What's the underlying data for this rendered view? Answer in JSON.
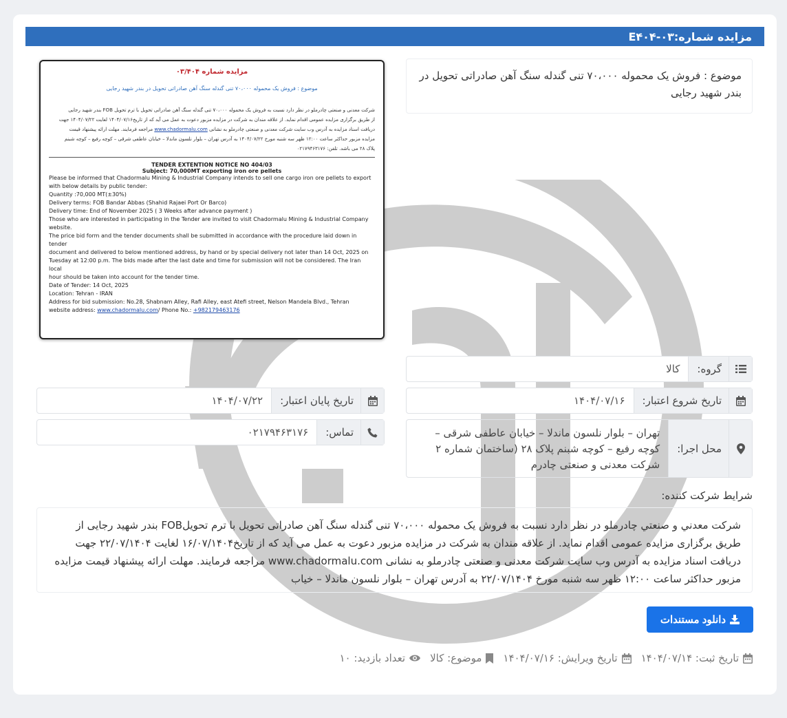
{
  "title": "مزایده شماره:۰۳-E۴۰۴",
  "subject": "موضوع : فروش یک محموله ۷۰،۰۰۰ تنی گندله سنگ آهن صادراتی تحویل در بندر شهید رجایی",
  "document_image": {
    "fa_title": "مزایده شماره ۰۳/۴۰۴",
    "fa_subject": "موضوع : فروش یک محموله   ۷۰،۰۰۰ تنی گندله سنگ آهن صادراتی تحویل در بندر شهید رجایی",
    "fa_line1": "شرکت معدنی و صنعتی چادرملو در نظر دارد نسبت به فروش یک محموله   ۷۰،۰۰۰ تنی گندله سنگ آهن صادراتی تحویل با ترم تحویل FOB بندر شهید رجایی",
    "fa_line2": "از طریق برگزاری مزایده عمومی اقدام نماید. از علاقه مندان به شرکت در مزایده مزبور دعوت به عمل می آید که از تاریخ۱۴۰۴/۰۷/۱۶ لغایت ۱۴۰۴/۰۷/۲۲ جهت",
    "fa_line3a": "دریافت اسناد مزایده به آدرس وب سایت شرکت معدنی و صنعتی چادرملو به نشانی",
    "fa_line3_link": "www.chadormalu.com",
    "fa_line3b": "مراجعه فرمایند. مهلت ارائه پیشنهاد قیمت",
    "fa_line4": "مزایده مزبور حداکثر ساعت ۱۲:۰۰ ظهر سه شنبه  مورخ ۱۴۰۴/۰۷/۲۲  به آدرس تهران – بلوار نلسون ماندلا – خیابان عاطفی شرقی – کوچه رفیع – کوچه شبنم",
    "fa_line5": "پلاک ۲۸ می باشد. تلفن: ۰۲۱۷۹۴۶۳۱۷۶",
    "en_title": "TENDER EXTENTION NOTICE NO 404/03",
    "en_subject": "Subject: 70,000MT exporting iron ore pellets",
    "en_lines": [
      "Please be informed that Chadormalu Mining & Industrial Company intends to sell one cargo iron ore pellets to export",
      "with below details by public tender:",
      "Quantity :70,000 MT(±30%)",
      "Delivery terms: FOB Bandar Abbas (Shahid Rajaei Port Or Barco)",
      "Delivery time:  End of November 2025 ( 3 Weeks after advance payment )",
      "Those who are interested in participating in the Tender are invited to visit Chadormalu Mining & Industrial Company",
      "website.",
      "The price bid form and the tender documents shall be submitted in accordance with the procedure laid down in tender",
      "document and delivered to below mentioned address, by hand or by special delivery not later than 14 Oct, 2025 on",
      "Tuesday at 12:00 p.m. The bids made after the last date and time for submission will not be considered. The Iran local",
      "hour should be taken into account for the tender time.",
      "Date of Tender:  14 Oct, 2025",
      "Location: Tehran - IRAN",
      "Address for bid submission: No.28, Shabnam Alley, Rafi Alley, east Atefi street, Nelson Mandela Blvd., Tehran"
    ],
    "en_website_label": "website address:",
    "en_website_link": "www.chadormalu.com",
    "en_phone_label": "/ Phone No.:",
    "en_phone_link": "+982179463176"
  },
  "fields": {
    "group_label": "گروه:",
    "group_value": "کالا",
    "start_label": "تاریخ شروع اعتبار:",
    "start_value": "۱۴۰۴/۰۷/۱۶",
    "end_label": "تاریخ پایان اعتبار:",
    "end_value": "۱۴۰۴/۰۷/۲۲",
    "location_label": "محل اجرا:",
    "location_value": "تهران – بلوار نلسون ماندلا – خیابان عاطفی شرقی – کوچه رفیع – کوچه شبنم پلاک ۲۸ (ساختمان شماره ۲ شرکت معدنی و صنعتی چادرم",
    "contact_label": "تماس:",
    "contact_value": "۰۲۱۷۹۴۶۳۱۷۶"
  },
  "conditions": {
    "label": "شرایط شرکت کننده:",
    "text": "شرکت معدني و صنعتي چادرملو در نظر دارد نسبت به فروش یک محموله ۷۰،۰۰۰ تنی گندله سنگ آهن صادراتی تحویل با ترم تحویلFOB بندر شهید رجایی از طریق برگزاری مزایده عمومی اقدام نماید. از علاقه مندان به شرکت در مزایده مزبور دعوت به عمل می آید که از تاریخ۱۶/۰۷/۱۴۰۴ لغایت ۲۲/۰۷/۱۴۰۴ جهت دریافت اسناد مزایده به آدرس وب سایت شرکت معدنی و صنعتی چادرملو به نشانی www.chadormalu.com مراجعه فرمایند. مهلت ارائه پیشنهاد قیمت مزایده مزبور حداکثر ساعت ۱۲:۰۰ ظهر سه شنبه مورخ ۲۲/۰۷/۱۴۰۴ به آدرس تهران – بلوار نلسون ماندلا – خیاب"
  },
  "download_label": "دانلود مستندات",
  "meta": {
    "registered": "تاریخ ثبت: ۱۴۰۴/۰۷/۱۴",
    "edited": "تاریخ ویرایش: ۱۴۰۴/۰۷/۱۶",
    "subject": "موضوع: کالا",
    "visits": "تعداد بازدید: ۱۰"
  },
  "colors": {
    "title_bar": "#2f6fbd",
    "button": "#1a73e8",
    "doc_title": "#c0262d"
  },
  "icons": [
    "list-icon",
    "calendar-icon",
    "map-marker-icon",
    "phone-icon",
    "download-icon",
    "bookmark-icon",
    "eye-icon"
  ]
}
